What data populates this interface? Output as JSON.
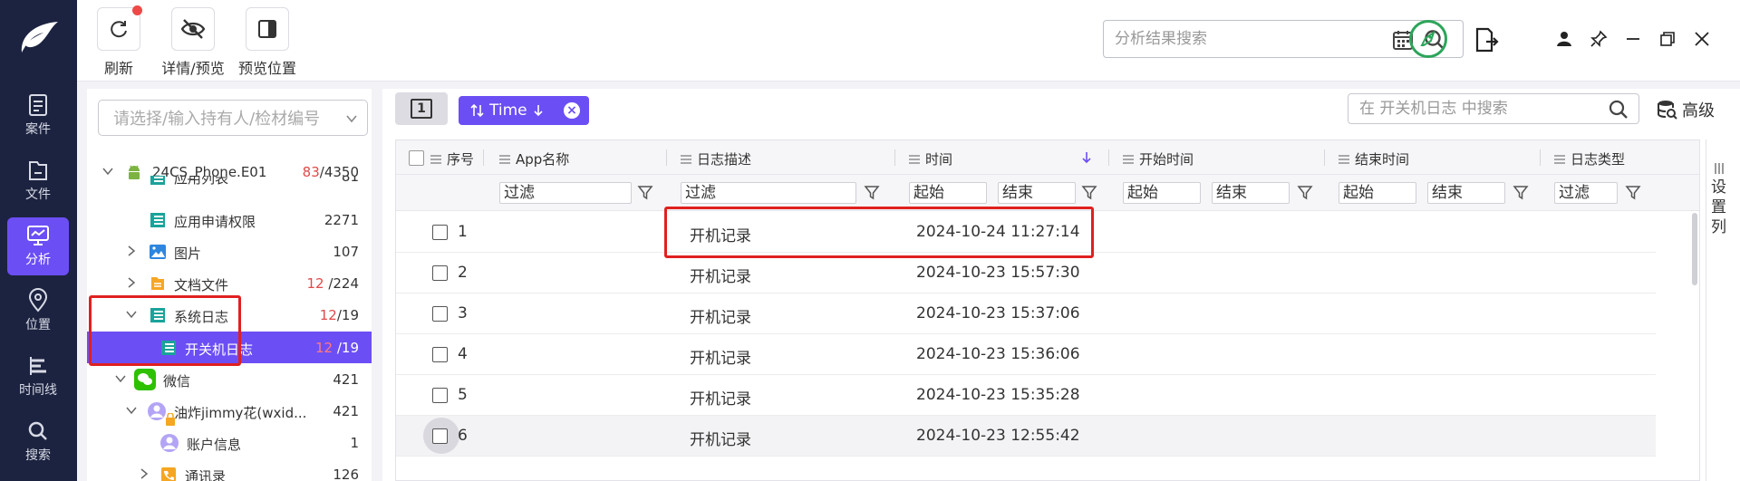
{
  "nav": {
    "items": [
      {
        "label": "案件",
        "icon": "case-icon"
      },
      {
        "label": "文件",
        "icon": "folder-icon"
      },
      {
        "label": "分析",
        "icon": "analysis-icon",
        "active": true
      },
      {
        "label": "位置",
        "icon": "location-icon"
      },
      {
        "label": "时间线",
        "icon": "timeline-icon"
      },
      {
        "label": "搜索",
        "icon": "search-icon"
      }
    ]
  },
  "toolbar": {
    "refresh_label": "刷新",
    "detail_label": "详情/预览",
    "preview_pos_label": "预览位置",
    "search_placeholder": "分析结果搜索"
  },
  "tree": {
    "select_placeholder": "请选择/输入持有人/检材编号",
    "root": {
      "label": "24CS_Phone.E01",
      "count_red": "83",
      "count_total": "/4350"
    },
    "items": [
      {
        "label": "应用列表",
        "count": "81"
      },
      {
        "label": "应用申请权限",
        "count": "2271"
      },
      {
        "label": "图片",
        "count": "107"
      },
      {
        "label": "文档文件",
        "count_red": "12",
        "count_total": " /224"
      },
      {
        "label": "系统日志",
        "count_red": "12",
        "count_total": "/19"
      },
      {
        "label": "开关机日志",
        "count_red": "12",
        "count_total": " /19"
      },
      {
        "label": "微信",
        "count": "421"
      },
      {
        "label": "油炸jimmy花(wxid...",
        "count": "421"
      },
      {
        "label": "账户信息",
        "count": "1"
      },
      {
        "label": "通讯录",
        "count": "126"
      }
    ]
  },
  "main": {
    "tab_number": "1",
    "sort_chip_label": "Time",
    "search_placeholder": "在 开关机日志 中搜索",
    "advanced_label": "高级",
    "columns": {
      "seq": "序号",
      "app": "App名称",
      "desc": "日志描述",
      "time": "时间",
      "start": "开始时间",
      "end": "结束时间",
      "type": "日志类型"
    },
    "filter": {
      "filter_label": "过滤",
      "from_label": "起始",
      "to_label": "结束"
    },
    "set_columns_label": "设置列",
    "rows": [
      {
        "seq": "1",
        "desc": "开机记录",
        "time": "2024-10-24 11:27:14"
      },
      {
        "seq": "2",
        "desc": "开机记录",
        "time": "2024-10-23 15:57:30"
      },
      {
        "seq": "3",
        "desc": "开机记录",
        "time": "2024-10-23 15:37:06"
      },
      {
        "seq": "4",
        "desc": "开机记录",
        "time": "2024-10-23 15:36:06"
      },
      {
        "seq": "5",
        "desc": "开机记录",
        "time": "2024-10-23 15:35:28"
      },
      {
        "seq": "6",
        "desc": "开机记录",
        "time": "2024-10-23 12:55:42"
      }
    ]
  },
  "colors": {
    "nav_bg": "#1c2340",
    "accent": "#6c4ef5",
    "highlight_red": "#e02020",
    "count_red": "#e04a4a"
  }
}
